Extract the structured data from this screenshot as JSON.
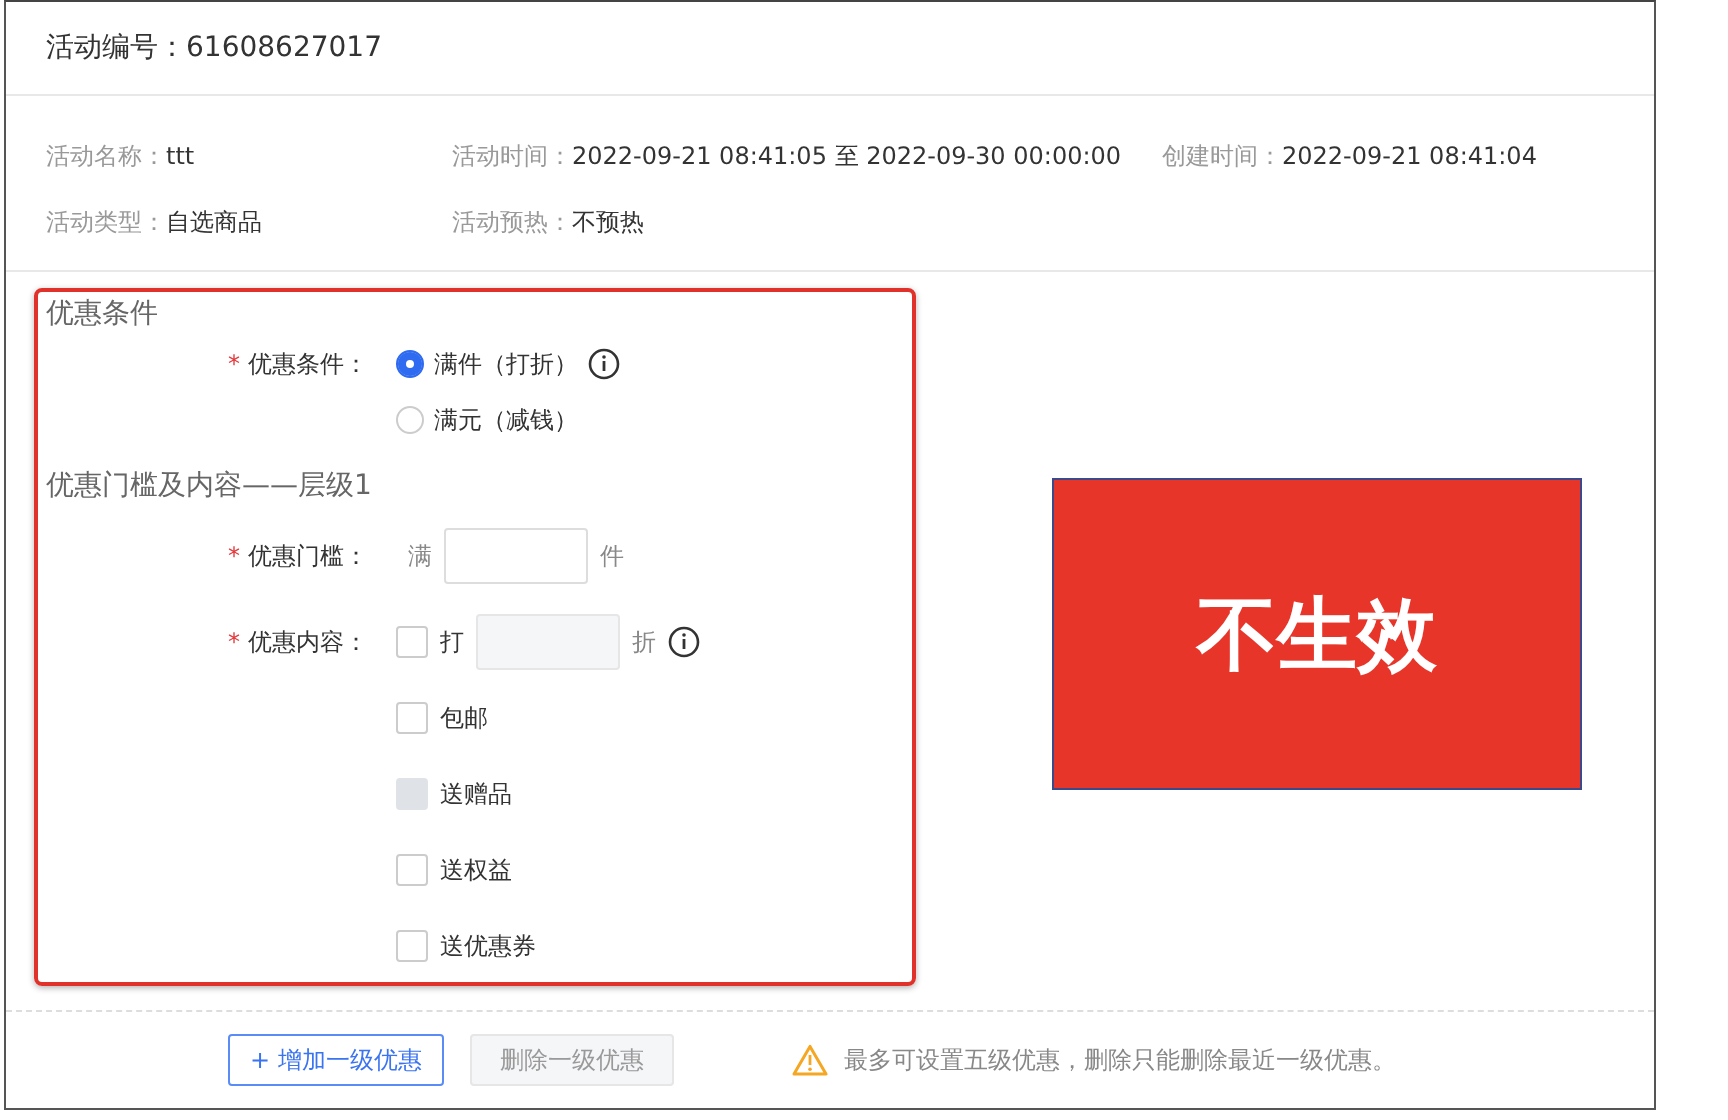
{
  "header": {
    "label": "活动编号：",
    "value": "61608627017"
  },
  "info_rows": [
    [
      {
        "label": "活动名称：",
        "value": "ttt"
      },
      {
        "label": "活动时间：",
        "value": "2022-09-21 08:41:05 至 2022-09-30 00:00:00"
      },
      {
        "label": "创建时间：",
        "value": "2022-09-21 08:41:04"
      }
    ],
    [
      {
        "label": "活动类型：",
        "value": "自选商品"
      },
      {
        "label": "活动预热：",
        "value": "不预热"
      }
    ]
  ],
  "condition": {
    "title": "优惠条件",
    "label": "优惠条件：",
    "required_mark": "*",
    "options": [
      {
        "label": "满件（打折）",
        "selected": true,
        "info": true
      },
      {
        "label": "满元（减钱）",
        "selected": false,
        "info": false
      }
    ]
  },
  "tier": {
    "title": "优惠门槛及内容——层级1",
    "threshold": {
      "label": "优惠门槛：",
      "required_mark": "*",
      "prefix": "满",
      "suffix": "件"
    },
    "content": {
      "label": "优惠内容：",
      "required_mark": "*",
      "items": [
        {
          "kind": "discount",
          "prefix": "打",
          "suffix": "折",
          "checked": false,
          "disabled": false,
          "info": true
        },
        {
          "kind": "plain",
          "label": "包邮",
          "checked": false,
          "disabled": false
        },
        {
          "kind": "plain",
          "label": "送赠品",
          "checked": false,
          "disabled": true
        },
        {
          "kind": "plain",
          "label": "送权益",
          "checked": false,
          "disabled": false
        },
        {
          "kind": "plain",
          "label": "送优惠券",
          "checked": false,
          "disabled": false
        }
      ]
    }
  },
  "note_block": {
    "text": "不生效"
  },
  "footer": {
    "buttons": [
      {
        "label": "+ 增加一级优惠",
        "disabled": false
      },
      {
        "label": "删除一级优惠",
        "disabled": true
      }
    ],
    "warning": "最多可设置五级优惠，删除只能删除最近一级优惠。"
  }
}
